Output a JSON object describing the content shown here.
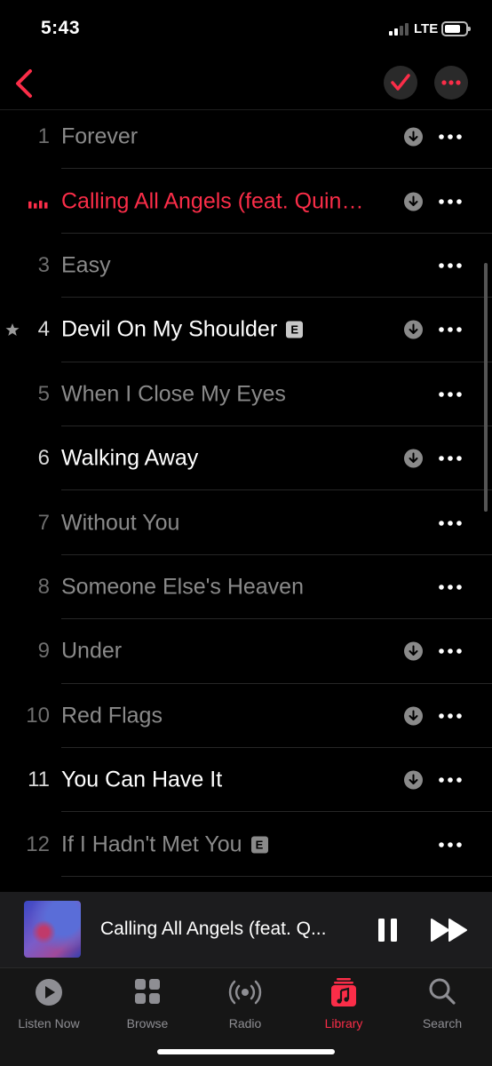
{
  "status_bar": {
    "time": "5:43",
    "network": "LTE"
  },
  "nav": {
    "back_icon": "chevron-left-icon",
    "select_icon": "checkmark-icon",
    "more_icon": "ellipsis-icon"
  },
  "colors": {
    "accent": "#fa2d48",
    "dim_text": "#8a8a8a",
    "bright_text": "#ffffff",
    "secondary": "#9a9a9a"
  },
  "tracks": [
    {
      "number": "1",
      "title": "Forever",
      "dimmed": true,
      "downloaded": true,
      "explicit": false,
      "playing": false,
      "starred": false
    },
    {
      "number": "",
      "title": "Calling All Angels (feat. Quin…",
      "dimmed": false,
      "downloaded": true,
      "explicit": false,
      "playing": true,
      "starred": false
    },
    {
      "number": "3",
      "title": "Easy",
      "dimmed": true,
      "downloaded": false,
      "explicit": false,
      "playing": false,
      "starred": false
    },
    {
      "number": "4",
      "title": "Devil On My Shoulder",
      "dimmed": false,
      "downloaded": true,
      "explicit": true,
      "playing": false,
      "starred": true
    },
    {
      "number": "5",
      "title": "When I Close My Eyes",
      "dimmed": true,
      "downloaded": false,
      "explicit": false,
      "playing": false,
      "starred": false
    },
    {
      "number": "6",
      "title": "Walking Away",
      "dimmed": false,
      "downloaded": true,
      "explicit": false,
      "playing": false,
      "starred": false
    },
    {
      "number": "7",
      "title": "Without You",
      "dimmed": true,
      "downloaded": false,
      "explicit": false,
      "playing": false,
      "starred": false
    },
    {
      "number": "8",
      "title": "Someone Else's Heaven",
      "dimmed": true,
      "downloaded": false,
      "explicit": false,
      "playing": false,
      "starred": false
    },
    {
      "number": "9",
      "title": "Under",
      "dimmed": true,
      "downloaded": true,
      "explicit": false,
      "playing": false,
      "starred": false
    },
    {
      "number": "10",
      "title": "Red Flags",
      "dimmed": true,
      "downloaded": true,
      "explicit": false,
      "playing": false,
      "starred": false
    },
    {
      "number": "11",
      "title": "You Can Have It",
      "dimmed": false,
      "downloaded": true,
      "explicit": false,
      "playing": false,
      "starred": false
    },
    {
      "number": "12",
      "title": "If I Hadn't Met You",
      "dimmed": true,
      "downloaded": false,
      "explicit": true,
      "playing": false,
      "starred": false
    }
  ],
  "explicit_badge": "E",
  "mini_player": {
    "title": "Calling All Angels (feat. Q...",
    "artwork_icon": "album-artwork",
    "pause_icon": "pause-icon",
    "forward_icon": "fast-forward-icon"
  },
  "tabs": [
    {
      "label": "Listen Now",
      "icon": "play-circle-icon",
      "active": false
    },
    {
      "label": "Browse",
      "icon": "grid-icon",
      "active": false
    },
    {
      "label": "Radio",
      "icon": "radio-waves-icon",
      "active": false
    },
    {
      "label": "Library",
      "icon": "music-library-icon",
      "active": true
    },
    {
      "label": "Search",
      "icon": "search-icon",
      "active": false
    }
  ]
}
